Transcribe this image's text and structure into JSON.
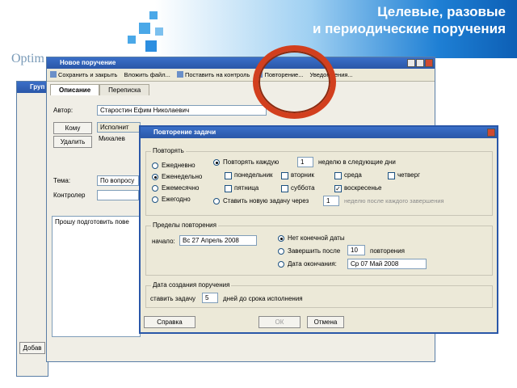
{
  "header": {
    "title_line1": "Целевые, разовые",
    "title_line2": "и периодические поручения",
    "brand": "Optim"
  },
  "back_window": {
    "title": "Груп"
  },
  "task_window": {
    "title": "Новое поручение",
    "toolbar": [
      "Сохранить и закрыть",
      "Вложить файл...",
      "Поставить на контроль",
      "Повторение...",
      "Уведомления..."
    ],
    "tabs": [
      "Описание",
      "Переписка"
    ],
    "author_label": "Автор:",
    "author_value": "Старостин Ефим Николаевич",
    "to_button": "Кому",
    "delete_button": "Удалить",
    "executor_header": "Исполнит",
    "executor_value": "Михалев",
    "subject_label": "Тема:",
    "subject_value": "По вопросу",
    "controller_label": "Контролер",
    "body_text": "Прошу подготовить пове",
    "add_button": "Добав",
    "help_button": "Справ"
  },
  "dialog": {
    "title": "Повторение задачи",
    "repeat_group": "Повторять",
    "options": [
      "Ежедневно",
      "Еженедельно",
      "Ежемесячно",
      "Ежегодно"
    ],
    "selected_option": "Еженедельно",
    "repeat_every_label": "Повторять каждую",
    "repeat_every_value": "1",
    "repeat_every_suffix": "неделю в следующие дни",
    "days": [
      "понедельник",
      "вторник",
      "среда",
      "четверг",
      "пятница",
      "суббота",
      "воскресенье"
    ],
    "checked_day": "воскресенье",
    "new_task_label": "Ставить новую задачу через",
    "new_task_value": "1",
    "new_task_suffix": "неделю после каждого завершения",
    "range_group": "Пределы повторения",
    "start_label": "начало:",
    "start_value": "Вс 27  Апрель  2008",
    "no_end_label": "Нет конечной даты",
    "end_after_label": "Завершить после",
    "end_after_value": "10",
    "end_after_suffix": "повторения",
    "end_date_label": "Дата окончания:",
    "end_date_value": "Ср 07      Май    2008",
    "creation_group": "Дата создания поручения",
    "create_label": "ставить задачу",
    "create_value": "5",
    "create_suffix": "дней до срока исполнения",
    "help_button": "Справка",
    "ok_button": "ОК",
    "cancel_button": "Отмена"
  },
  "colors": {
    "accent": "#2a57a8",
    "highlight_circle": "#d23f1e"
  }
}
